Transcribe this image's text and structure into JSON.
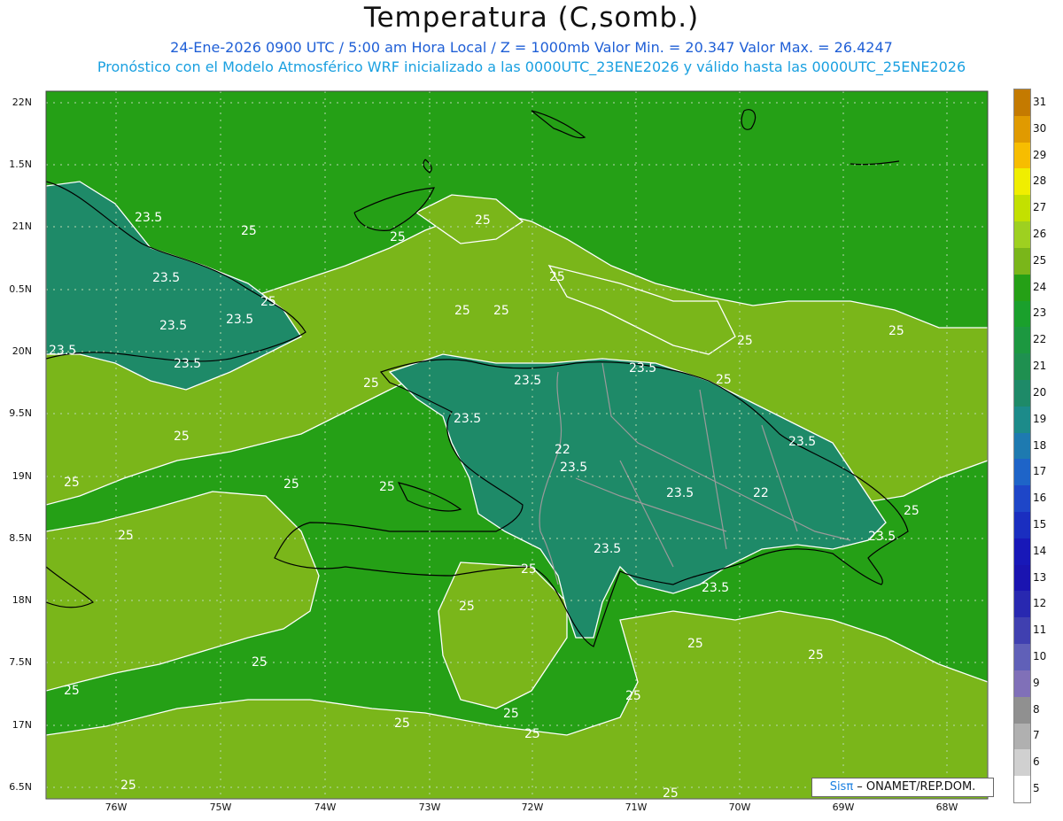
{
  "header": {
    "title": "Temperatura (C,somb.)",
    "subtitle_line1": "24-Ene-2026  0900 UTC / 5:00 am Hora Local / Z = 1000mb    Valor Min. = 20.347  Valor Max. = 26.4247",
    "subtitle_line2": "Pronóstico con el Modelo Atmosférico WRF inicializado a las 0000UTC_23ENE2026 y válido hasta las  0000UTC_25ENE2026"
  },
  "axes": {
    "lat_labels": [
      "22N",
      "1.5N",
      "21N",
      "0.5N",
      "20N",
      "9.5N",
      "19N",
      "8.5N",
      "18N",
      "7.5N",
      "17N",
      "6.5N"
    ],
    "lon_labels": [
      "76W",
      "75W",
      "74W",
      "73W",
      "72W",
      "71W",
      "70W",
      "69W",
      "68W"
    ]
  },
  "colorbar": {
    "levels": [
      "31",
      "30",
      "29",
      "28",
      "27",
      "26",
      "25",
      "24",
      "23",
      "22",
      "21",
      "20",
      "19",
      "18",
      "17",
      "16",
      "15",
      "14",
      "13",
      "12",
      "11",
      "10",
      "9",
      "8",
      "7",
      "6",
      "5"
    ],
    "colors": [
      "#c47a00",
      "#e09a00",
      "#f7bd00",
      "#f0ee00",
      "#c3e000",
      "#9ed020",
      "#7ab61a",
      "#25a016",
      "#1aa02c",
      "#1c9840",
      "#1f9050",
      "#1e8a68",
      "#1c8b8a",
      "#1e7ab0",
      "#1e64c8",
      "#1e46c8",
      "#1a2ec0",
      "#1818b8",
      "#1a14b0",
      "#2828b0",
      "#4040b0",
      "#6060b8",
      "#8070b8",
      "#909090",
      "#b0b0b0",
      "#d0d0d0",
      "#ffffff"
    ]
  },
  "contour_labels": [
    "23.5",
    "25",
    "22"
  ],
  "credit": {
    "logo": "Sisπ",
    "text": " – ONAMET/REP.DOM."
  },
  "colors": {
    "ocean": "#25a016",
    "warm": "#7ab61a",
    "cool": "#1e8a68",
    "coast": "#000000",
    "contour": "#ffffff"
  }
}
